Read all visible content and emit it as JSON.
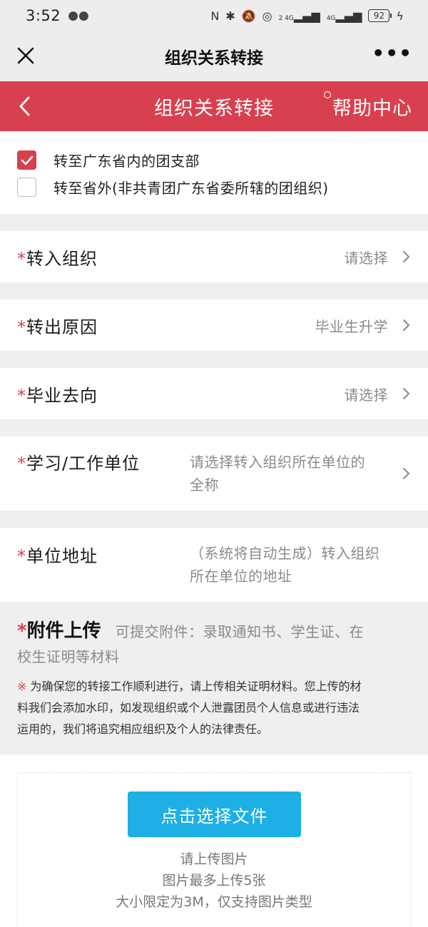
{
  "status": {
    "time": "3:52",
    "battery": "92",
    "network_1": "2 4G",
    "network_2": "4G"
  },
  "titlebar": {
    "title": "组织关系转接",
    "more": "•••"
  },
  "header": {
    "title": "组织关系转接",
    "help": "帮助中心"
  },
  "options": [
    {
      "label": "转至广东省内的团支部",
      "checked": true
    },
    {
      "label": "转至省外(非共青团广东省委所辖的团组织)",
      "checked": false
    }
  ],
  "fields": {
    "required_mark": "*",
    "target_org": {
      "label": "转入组织",
      "value": "请选择"
    },
    "reason": {
      "label": "转出原因",
      "value": "毕业生升学"
    },
    "destination": {
      "label": "毕业去向",
      "value": "请选择"
    },
    "work_unit": {
      "label": "学习/工作单位",
      "value_line1": "请选择转入组织所在单位的",
      "value_line2": "全称"
    },
    "unit_address": {
      "label": "单位地址",
      "value_line1": "（系统将自动生成）转入组织",
      "value_line2": "所在单位的地址"
    }
  },
  "upload": {
    "title": "附件上传",
    "hint_line1": "可提交附件：录取通知书、学生证、在",
    "hint_line2": "校生证明等材料",
    "warning_mark": "※",
    "warning_line1": "为确保您的转接工作顺利进行，请上传相关证明材料。您上传的材",
    "warning_line2": "料我们会添加水印，如发现组织或个人泄露团员个人信息或进行违法",
    "warning_line3": "运用的，我们将追究相应组织及个人的法律责任。",
    "button": "点击选择文件",
    "note1": "请上传图片",
    "note2": "图片最多上传5张",
    "note3": "大小限定为3M，仅支持图片类型"
  },
  "colors": {
    "brand_red": "#d9404f",
    "button_blue": "#1eafe5"
  }
}
